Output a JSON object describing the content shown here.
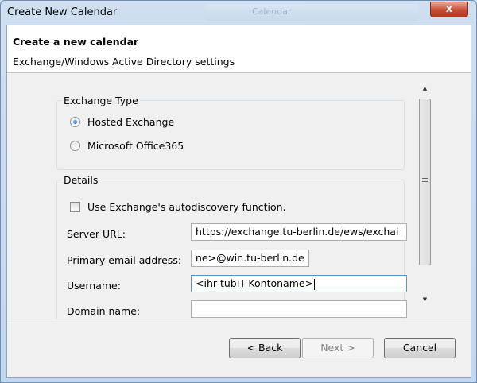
{
  "window": {
    "title": "Create New Calendar",
    "background_tab": "Calendar",
    "close_glyph": "x"
  },
  "header": {
    "title": "Create a new calendar",
    "subtitle": "Exchange/Windows Active Directory settings"
  },
  "exchange_type": {
    "legend": "Exchange Type",
    "options": [
      {
        "label": "Hosted Exchange",
        "selected": true
      },
      {
        "label": "Microsoft Office365",
        "selected": false
      }
    ]
  },
  "details": {
    "legend": "Details",
    "autodiscovery": {
      "label": "Use Exchange's autodiscovery function.",
      "checked": false
    },
    "server_url": {
      "label": "Server URL:",
      "value": "https://exchange.tu-berlin.de/ews/exchai"
    },
    "primary_email": {
      "label": "Primary email address:",
      "value": "ne>@win.tu-berlin.de"
    },
    "username": {
      "label": "Username:",
      "value": "<ihr tubIT-Kontoname>"
    },
    "domain_name": {
      "label": "Domain name:",
      "value": ""
    }
  },
  "buttons": {
    "back": "< Back",
    "next": "Next >",
    "cancel": "Cancel"
  },
  "colors": {
    "titlebar": "#cfdff0",
    "close_button": "#c64b33",
    "dialog_bg": "#f0f0f0"
  }
}
